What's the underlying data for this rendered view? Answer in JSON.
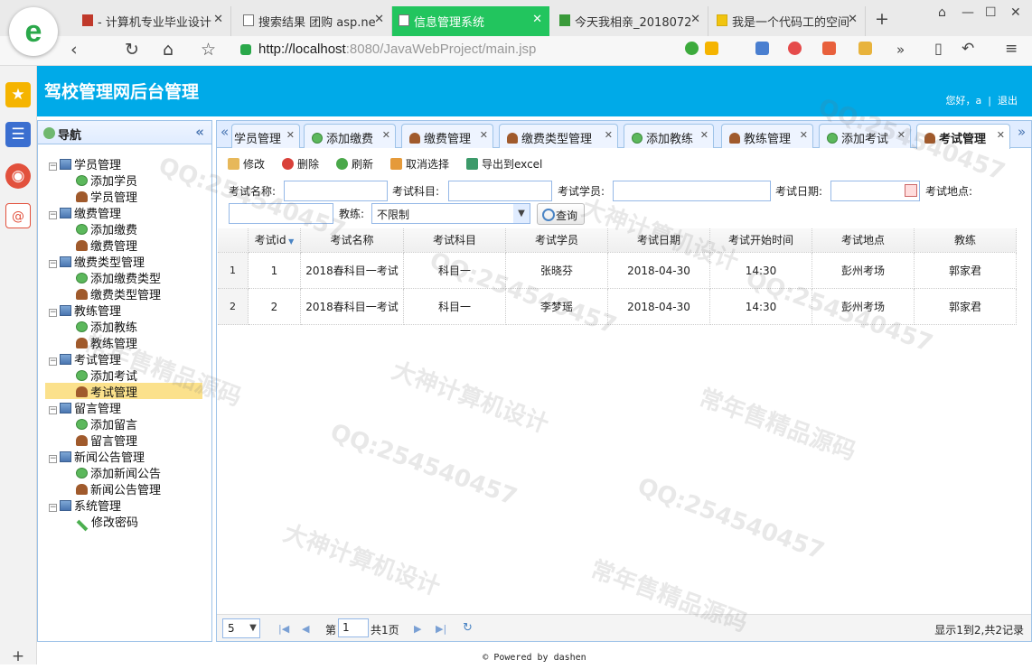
{
  "browser": {
    "tabs": [
      {
        "title": "- 计算机专业毕业设计"
      },
      {
        "title": "搜索结果 团购 asp.ne"
      },
      {
        "title": "信息管理系统"
      },
      {
        "title": "今天我相亲_2018072"
      },
      {
        "title": "我是一个代码工的空间"
      }
    ],
    "url_host": "http://localhost",
    "url_rest": ":8080/JavaWebProject/main.jsp"
  },
  "header": {
    "title": "驾校管理网后台管理",
    "greeting": "您好，a",
    "logout": "退出"
  },
  "nav": {
    "title": "导航",
    "groups": [
      {
        "label": "学员管理",
        "items": [
          "添加学员",
          "学员管理"
        ]
      },
      {
        "label": "缴费管理",
        "items": [
          "添加缴费",
          "缴费管理"
        ]
      },
      {
        "label": "缴费类型管理",
        "items": [
          "添加缴费类型",
          "缴费类型管理"
        ]
      },
      {
        "label": "教练管理",
        "items": [
          "添加教练",
          "教练管理"
        ]
      },
      {
        "label": "考试管理",
        "items": [
          "添加考试",
          "考试管理"
        ]
      },
      {
        "label": "留言管理",
        "items": [
          "添加留言",
          "留言管理"
        ]
      },
      {
        "label": "新闻公告管理",
        "items": [
          "添加新闻公告",
          "新闻公告管理"
        ]
      },
      {
        "label": "系统管理",
        "items": [
          "修改密码"
        ]
      }
    ]
  },
  "tabs": [
    "学员管理",
    "添加缴费",
    "缴费管理",
    "缴费类型管理",
    "添加教练",
    "教练管理",
    "添加考试",
    "考试管理"
  ],
  "toolbar": {
    "edit": "修改",
    "delete": "删除",
    "refresh": "刷新",
    "cancel_select": "取消选择",
    "export": "导出到excel"
  },
  "search": {
    "name_label": "考试名称:",
    "subject_label": "考试科目:",
    "student_label": "考试学员:",
    "date_label": "考试日期:",
    "place_label": "考试地点:",
    "coach_label": "教练:",
    "coach_value": "不限制",
    "query_button": "查询"
  },
  "grid": {
    "headers": [
      "考试id",
      "考试名称",
      "考试科目",
      "考试学员",
      "考试日期",
      "考试开始时间",
      "考试地点",
      "教练"
    ],
    "rows": [
      {
        "rn": "1",
        "cells": [
          "1",
          "2018春科目一考试",
          "科目一",
          "张晓芬",
          "2018-04-30",
          "14:30",
          "彭州考场",
          "郭家君"
        ]
      },
      {
        "rn": "2",
        "cells": [
          "2",
          "2018春科目一考试",
          "科目一",
          "李梦瑶",
          "2018-04-30",
          "14:30",
          "彭州考场",
          "郭家君"
        ]
      }
    ]
  },
  "pager": {
    "page_size": "5",
    "page_prefix": "第",
    "page_value": "1",
    "page_total": "共1页",
    "summary": "显示1到2,共2记录"
  },
  "footer": "© Powered by dashen",
  "watermarks": [
    "QQ:254540457",
    "常年售精品源码",
    "大神计算机设计"
  ]
}
